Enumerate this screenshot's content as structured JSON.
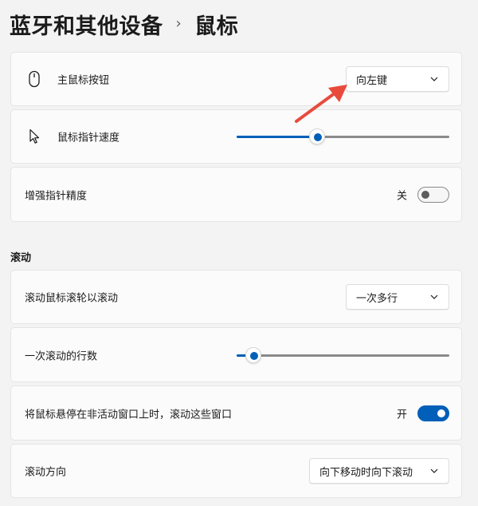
{
  "breadcrumb": {
    "parent": "蓝牙和其他设备",
    "separator": "›",
    "current": "鼠标"
  },
  "mouse_settings": {
    "primary_button": {
      "icon": "mouse-icon",
      "label": "主鼠标按钮",
      "value": "向左键"
    },
    "pointer_speed": {
      "icon": "pointer-icon",
      "label": "鼠标指针速度",
      "level_fraction": 0.38
    },
    "enhance_precision": {
      "label": "增强指针精度",
      "state_text": "关",
      "on": false
    }
  },
  "scrolling": {
    "section_title": "滚动",
    "wheel_scroll": {
      "label": "滚动鼠标滚轮以滚动",
      "value": "一次多行"
    },
    "lines_per_scroll": {
      "label": "一次滚动的行数",
      "level_fraction": 0.08
    },
    "inactive_windows": {
      "label": "将鼠标悬停在非活动窗口上时，滚动这些窗口",
      "state_text": "开",
      "on": true
    },
    "scroll_direction": {
      "label": "滚动方向",
      "value": "向下移动时向下滚动"
    }
  },
  "colors": {
    "accent": "#005fb8",
    "annotation_arrow": "#e84b3c",
    "background": "#f3f3f3",
    "card": "#fbfbfb"
  }
}
